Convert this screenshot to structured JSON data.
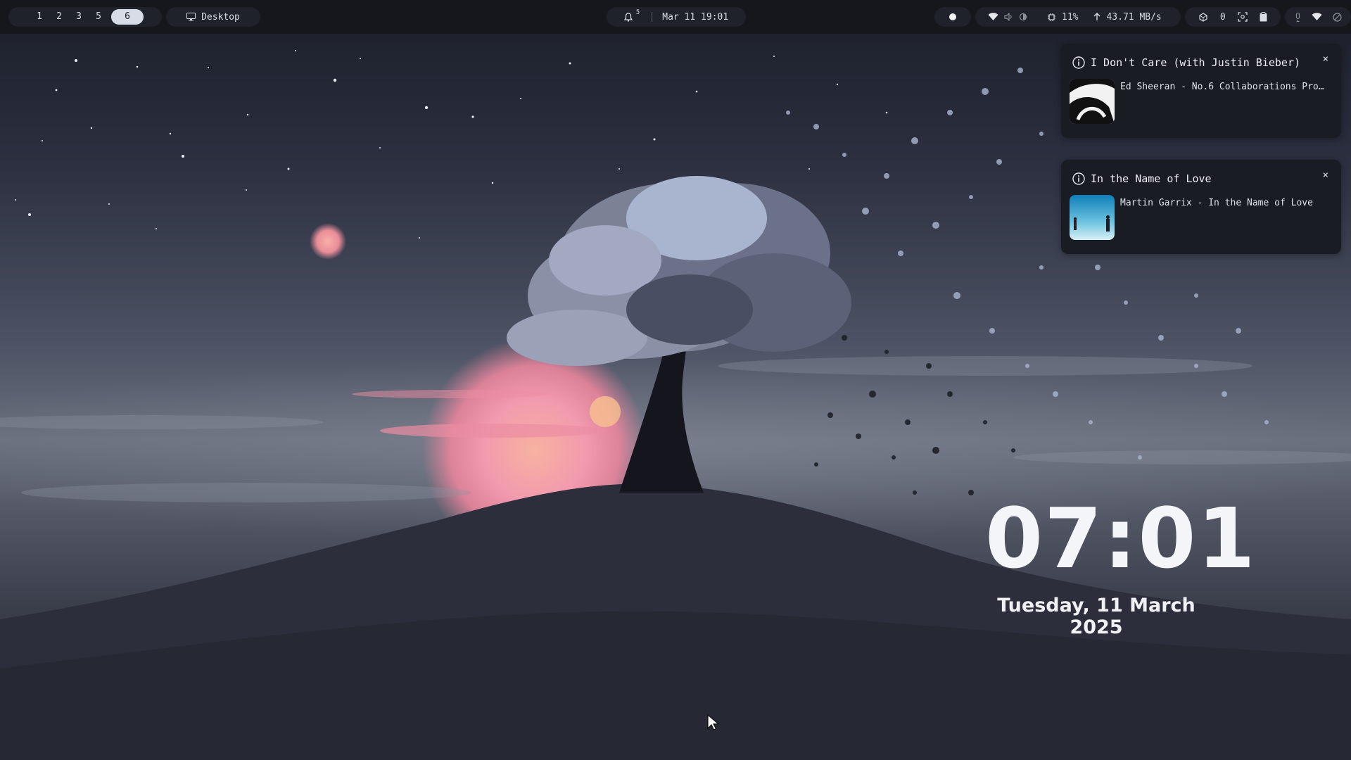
{
  "workspaces": [
    "1",
    "2",
    "3",
    "5",
    "6"
  ],
  "active_workspace": "6",
  "window_title": "Desktop",
  "notification_count": "5",
  "datetime": "Mar 11 19:01",
  "stats": {
    "cpu": "11%",
    "network": "43.71 MB/s",
    "updates": "0"
  },
  "notifications": [
    {
      "title": "I Don't Care (with Justin Bieber)",
      "body": "Ed Sheeran - No.6 Collaborations Pro…",
      "close": "×"
    },
    {
      "title": "In the Name of Love",
      "body": "Martin Garrix - In the Name of Love",
      "close": "×"
    }
  ],
  "lockscreen": {
    "time": "07:01",
    "date": "Tuesday, 11 March 2025"
  },
  "colors": {
    "bar": "#15171d",
    "pill": "#1f222b",
    "active_ws": "#d8dce6",
    "sun": "#f08aa0"
  }
}
